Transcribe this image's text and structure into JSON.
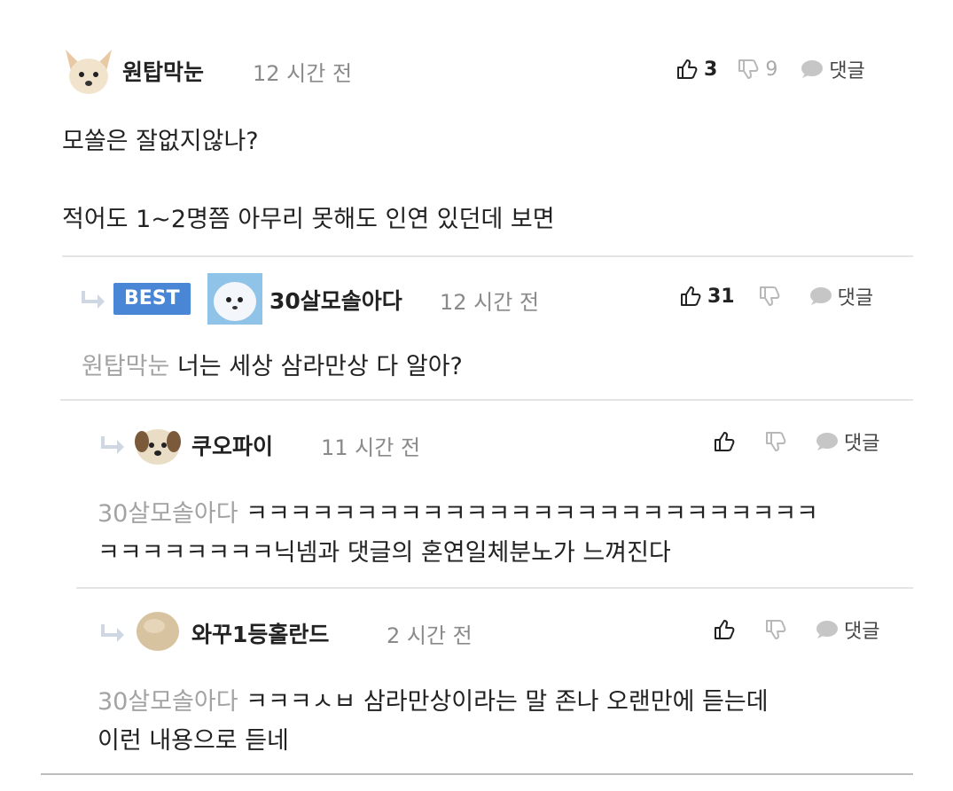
{
  "comments": [
    {
      "author": "원탑막눈",
      "time": "12 시간 전",
      "likes": "3",
      "dislikes": "9",
      "reply_label": "댓글",
      "lines": [
        "모쏠은 잘없지않나?",
        "적어도 1~2명쯤 아무리 못해도 인연 있던데 보면"
      ]
    },
    {
      "badge": "BEST",
      "author": "30살모솔아다",
      "time": "12 시간 전",
      "likes": "31",
      "reply_label": "댓글",
      "mention": "원탑막눈",
      "text": "너는 세상 삼라만상 다 알아?"
    },
    {
      "author": "쿠오파이",
      "time": "11 시간 전",
      "reply_label": "댓글",
      "mention": "30살모솔아다",
      "line1": "ㅋㅋㅋㅋㅋㅋㅋㅋㅋㅋㅋㅋㅋㅋㅋㅋㅋㅋㅋㅋㅋㅋㅋㅋㅋㅋ",
      "line2": "ㅋㅋㅋㅋㅋㅋㅋㅋ닉넴과 댓글의 혼연일체분노가 느껴진다"
    },
    {
      "author": "와꾸1등홀란드",
      "time": "2 시간 전",
      "reply_label": "댓글",
      "mention": "30살모솔아다",
      "line1": "ㅋㅋㅋㅅㅂ 삼라만상이라는 말 존나 오랜만에 듣는데",
      "line2": "이런 내용으로 듣네"
    }
  ],
  "colors": {
    "best_badge": "#4a86d6",
    "divider": "#e4e4e4",
    "mention": "#a3a3a3"
  }
}
